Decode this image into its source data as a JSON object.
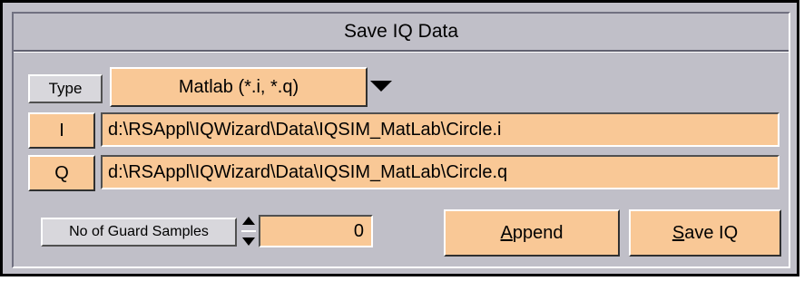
{
  "title": "Save IQ Data",
  "type_label": "Type",
  "type_value": "Matlab (*.i, *.q)",
  "i_label": "I",
  "i_path": "d:\\RSAppl\\IQWizard\\Data\\IQSIM_MatLab\\Circle.i",
  "q_label": "Q",
  "q_path": "d:\\RSAppl\\IQWizard\\Data\\IQSIM_MatLab\\Circle.q",
  "guard_label": "No of Guard Samples",
  "guard_value": "0",
  "append_mnemonic": "A",
  "append_rest": "ppend",
  "save_mnemonic": "S",
  "save_rest": "ave IQ",
  "colors": {
    "accent": "#f9c896",
    "panel": "#c0bfc8"
  },
  "icons": {
    "dropdown": "triangle-down-icon",
    "spinner": "up-down-spinner-icon"
  }
}
